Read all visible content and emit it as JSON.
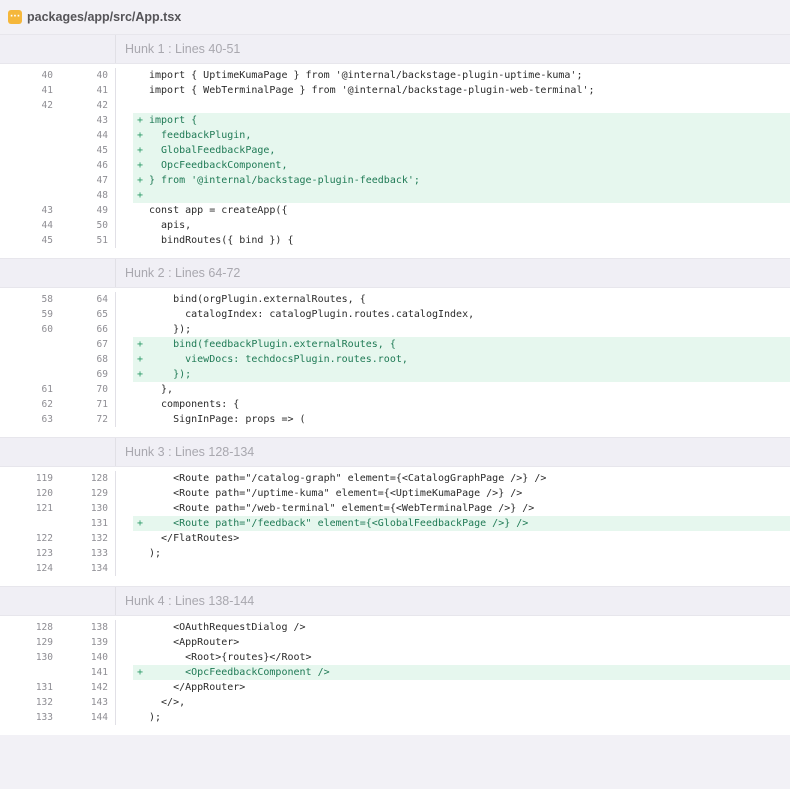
{
  "file": {
    "icon": "file-code-icon",
    "icon_glyph": "···",
    "path": "packages/app/src/App.tsx"
  },
  "hunks": [
    {
      "title": "Hunk 1 : Lines 40-51",
      "lines": [
        {
          "old": "40",
          "new": "40",
          "type": "ctx",
          "marker": " ",
          "code": "import { UptimeKumaPage } from '@internal/backstage-plugin-uptime-kuma';"
        },
        {
          "old": "41",
          "new": "41",
          "type": "ctx",
          "marker": " ",
          "code": "import { WebTerminalPage } from '@internal/backstage-plugin-web-terminal';"
        },
        {
          "old": "42",
          "new": "42",
          "type": "ctx",
          "marker": " ",
          "code": ""
        },
        {
          "old": "",
          "new": "43",
          "type": "added",
          "marker": "+",
          "code": "import {"
        },
        {
          "old": "",
          "new": "44",
          "type": "added",
          "marker": "+",
          "code": "  feedbackPlugin,"
        },
        {
          "old": "",
          "new": "45",
          "type": "added",
          "marker": "+",
          "code": "  GlobalFeedbackPage,"
        },
        {
          "old": "",
          "new": "46",
          "type": "added",
          "marker": "+",
          "code": "  OpcFeedbackComponent,"
        },
        {
          "old": "",
          "new": "47",
          "type": "added",
          "marker": "+",
          "code": "} from '@internal/backstage-plugin-feedback';"
        },
        {
          "old": "",
          "new": "48",
          "type": "added",
          "marker": "+",
          "code": ""
        },
        {
          "old": "43",
          "new": "49",
          "type": "ctx",
          "marker": " ",
          "code": "const app = createApp({"
        },
        {
          "old": "44",
          "new": "50",
          "type": "ctx",
          "marker": " ",
          "code": "  apis,"
        },
        {
          "old": "45",
          "new": "51",
          "type": "ctx",
          "marker": " ",
          "code": "  bindRoutes({ bind }) {"
        }
      ]
    },
    {
      "title": "Hunk 2 : Lines 64-72",
      "lines": [
        {
          "old": "58",
          "new": "64",
          "type": "ctx",
          "marker": " ",
          "code": "    bind(orgPlugin.externalRoutes, {"
        },
        {
          "old": "59",
          "new": "65",
          "type": "ctx",
          "marker": " ",
          "code": "      catalogIndex: catalogPlugin.routes.catalogIndex,"
        },
        {
          "old": "60",
          "new": "66",
          "type": "ctx",
          "marker": " ",
          "code": "    });"
        },
        {
          "old": "",
          "new": "67",
          "type": "added",
          "marker": "+",
          "code": "    bind(feedbackPlugin.externalRoutes, {"
        },
        {
          "old": "",
          "new": "68",
          "type": "added",
          "marker": "+",
          "code": "      viewDocs: techdocsPlugin.routes.root,"
        },
        {
          "old": "",
          "new": "69",
          "type": "added",
          "marker": "+",
          "code": "    });"
        },
        {
          "old": "61",
          "new": "70",
          "type": "ctx",
          "marker": " ",
          "code": "  },"
        },
        {
          "old": "62",
          "new": "71",
          "type": "ctx",
          "marker": " ",
          "code": "  components: {"
        },
        {
          "old": "63",
          "new": "72",
          "type": "ctx",
          "marker": " ",
          "code": "    SignInPage: props => ("
        }
      ]
    },
    {
      "title": "Hunk 3 : Lines 128-134",
      "lines": [
        {
          "old": "119",
          "new": "128",
          "type": "ctx",
          "marker": " ",
          "code": "    <Route path=\"/catalog-graph\" element={<CatalogGraphPage />} />"
        },
        {
          "old": "120",
          "new": "129",
          "type": "ctx",
          "marker": " ",
          "code": "    <Route path=\"/uptime-kuma\" element={<UptimeKumaPage />} />"
        },
        {
          "old": "121",
          "new": "130",
          "type": "ctx",
          "marker": " ",
          "code": "    <Route path=\"/web-terminal\" element={<WebTerminalPage />} />"
        },
        {
          "old": "",
          "new": "131",
          "type": "added",
          "marker": "+",
          "code": "    <Route path=\"/feedback\" element={<GlobalFeedbackPage />} />"
        },
        {
          "old": "122",
          "new": "132",
          "type": "ctx",
          "marker": " ",
          "code": "  </FlatRoutes>"
        },
        {
          "old": "123",
          "new": "133",
          "type": "ctx",
          "marker": " ",
          "code": ");"
        },
        {
          "old": "124",
          "new": "134",
          "type": "ctx",
          "marker": " ",
          "code": ""
        }
      ]
    },
    {
      "title": "Hunk 4 : Lines 138-144",
      "lines": [
        {
          "old": "128",
          "new": "138",
          "type": "ctx",
          "marker": " ",
          "code": "    <OAuthRequestDialog />"
        },
        {
          "old": "129",
          "new": "139",
          "type": "ctx",
          "marker": " ",
          "code": "    <AppRouter>"
        },
        {
          "old": "130",
          "new": "140",
          "type": "ctx",
          "marker": " ",
          "code": "      <Root>{routes}</Root>"
        },
        {
          "old": "",
          "new": "141",
          "type": "added",
          "marker": "+",
          "code": "      <OpcFeedbackComponent />"
        },
        {
          "old": "131",
          "new": "142",
          "type": "ctx",
          "marker": " ",
          "code": "    </AppRouter>"
        },
        {
          "old": "132",
          "new": "143",
          "type": "ctx",
          "marker": " ",
          "code": "  </>,"
        },
        {
          "old": "133",
          "new": "144",
          "type": "ctx",
          "marker": " ",
          "code": ");"
        }
      ]
    }
  ]
}
